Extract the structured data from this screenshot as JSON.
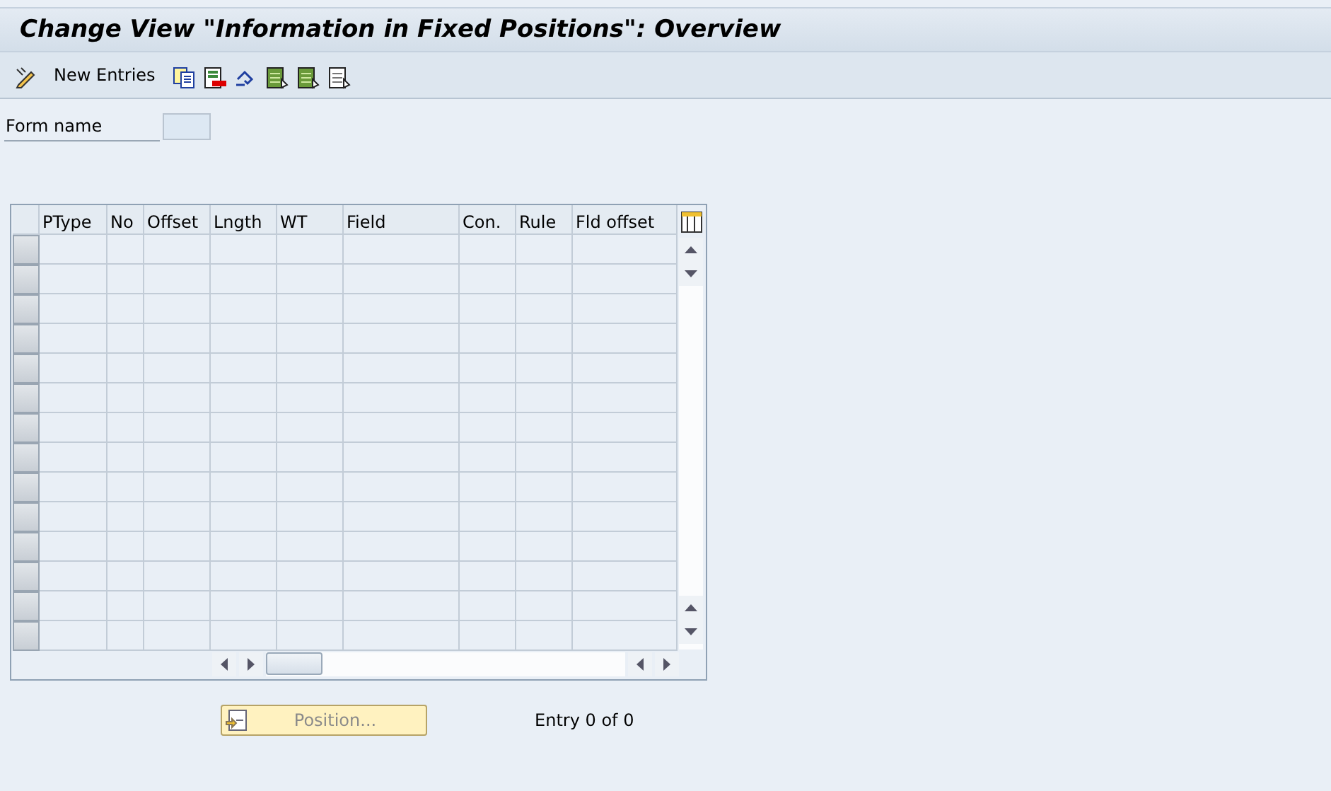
{
  "window": {
    "title": "Change View \"Information in Fixed Positions\": Overview"
  },
  "toolbar": {
    "new_entries": "New Entries"
  },
  "form": {
    "label": "Form name"
  },
  "table": {
    "columns": [
      "PType",
      "No",
      "Offset",
      "Lngth",
      "WT",
      "Field",
      "Con.",
      "Rule",
      "Fld offset"
    ]
  },
  "position_button": {
    "label": "Position...",
    "disabled": true
  },
  "entry_status": "Entry 0 of 0"
}
